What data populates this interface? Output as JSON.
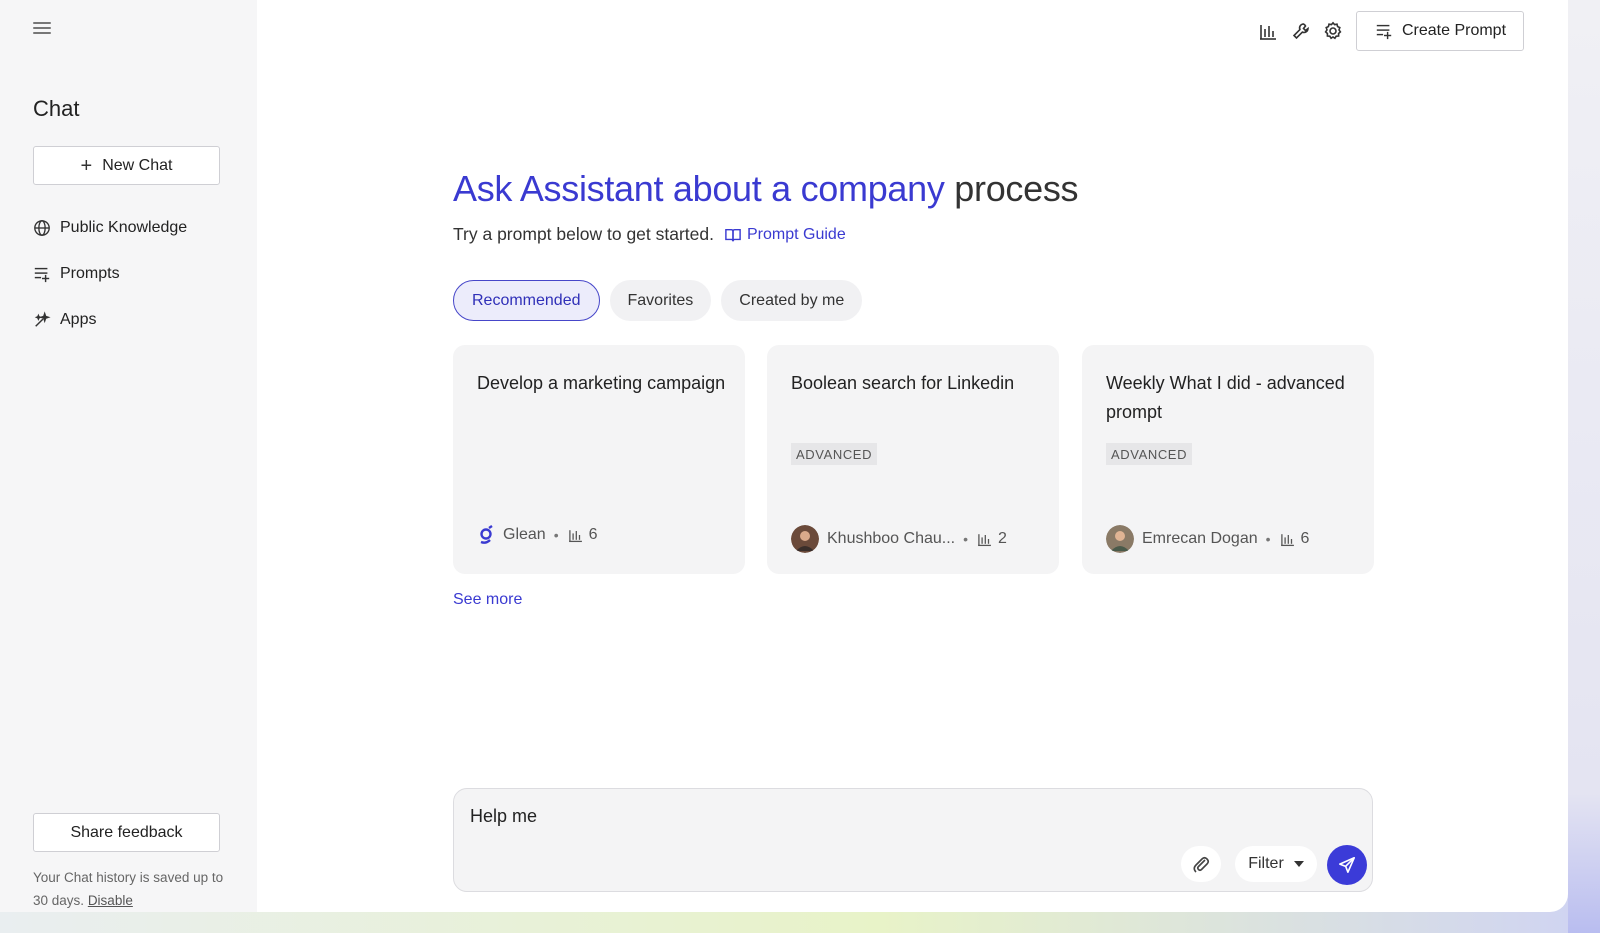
{
  "sidebar": {
    "title": "Chat",
    "new_chat_label": "New Chat",
    "items": [
      {
        "label": "Public Knowledge",
        "icon": "globe-icon"
      },
      {
        "label": "Prompts",
        "icon": "prompts-icon"
      },
      {
        "label": "Apps",
        "icon": "sparkle-icon"
      }
    ],
    "share_feedback_label": "Share feedback",
    "history_note": "Your Chat history is saved up to 30 days.",
    "disable_label": "Disable"
  },
  "toolbar": {
    "icons": [
      "analytics-icon",
      "wrench-icon",
      "gear-icon"
    ],
    "create_prompt_label": "Create Prompt"
  },
  "main": {
    "title_highlight": "Ask Assistant about a company",
    "title_rest": "process",
    "subtitle": "Try a prompt below to get started.",
    "prompt_guide_label": "Prompt Guide",
    "tabs": [
      {
        "label": "Recommended",
        "active": true
      },
      {
        "label": "Favorites",
        "active": false
      },
      {
        "label": "Created by me",
        "active": false
      }
    ],
    "cards": [
      {
        "title": "Develop a marketing campaign",
        "badge": "",
        "author": "Glean",
        "uses": "6"
      },
      {
        "title": "Boolean search for Linkedin",
        "badge": "ADVANCED",
        "author": "Khushboo Chau...",
        "uses": "2"
      },
      {
        "title": "Weekly What I did - advanced prompt",
        "badge": "ADVANCED",
        "author": "Emrecan Dogan",
        "uses": "6"
      }
    ],
    "see_more_label": "See more"
  },
  "composer": {
    "value": "Help me",
    "filter_label": "Filter"
  },
  "colors": {
    "accent": "#3a3ad1",
    "send_button": "#3b3bd8"
  }
}
